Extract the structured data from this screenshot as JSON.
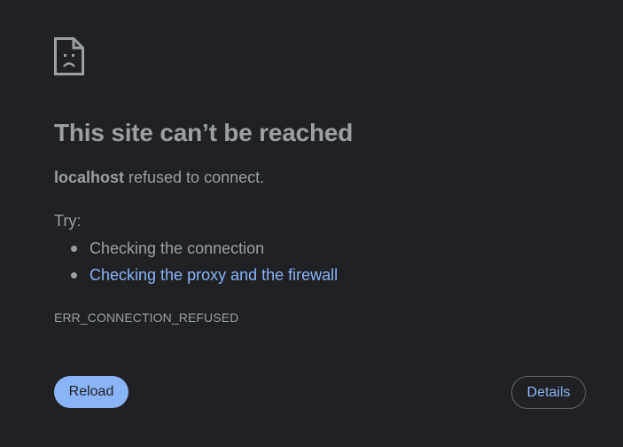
{
  "error_page": {
    "icon": "sad-page-icon",
    "title": "This site can’t be reached",
    "host": "localhost",
    "message_suffix": " refused to connect.",
    "try_label": "Try:",
    "suggestions": [
      {
        "text": "Checking the connection",
        "is_link": false
      },
      {
        "text": "Checking the proxy and the firewall",
        "is_link": true
      }
    ],
    "error_code": "ERR_CONNECTION_REFUSED"
  },
  "buttons": {
    "reload_label": "Reload",
    "details_label": "Details"
  },
  "colors": {
    "background": "#202124",
    "text": "#9aa0a6",
    "accent": "#8ab4f8",
    "button_border": "#5f6368"
  }
}
